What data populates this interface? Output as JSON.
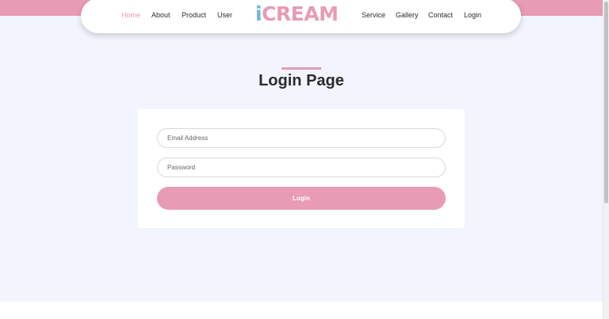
{
  "nav": {
    "left_links": [
      "Home",
      "About",
      "Product",
      "User"
    ],
    "right_links": [
      "Service",
      "Gallery",
      "Contact",
      "Login"
    ],
    "active": "Home",
    "logo_first": "i",
    "logo_rest": "CREAM"
  },
  "page": {
    "title": "Login Page"
  },
  "form": {
    "email_placeholder": "Email Address",
    "password_placeholder": "Password",
    "login_label": "Login"
  },
  "colors": {
    "accent_pink": "#E89BB5",
    "logo_blue": "#6FB6E3",
    "background": "#F2F5FF"
  }
}
